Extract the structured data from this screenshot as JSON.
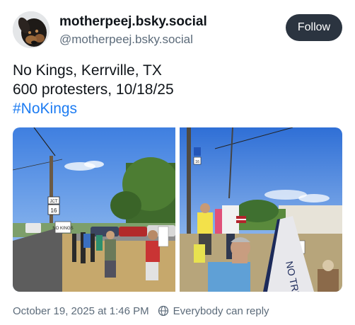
{
  "author": {
    "display_name": "motherpeej.bsky.social",
    "handle": "@motherpeej.bsky.social",
    "avatar_icon": "dog-avatar"
  },
  "follow_button": {
    "label": "Follow"
  },
  "post": {
    "lines": [
      "No Kings, Kerrville, TX",
      "600 protesters, 10/18/25"
    ],
    "hashtag": "#NoKings"
  },
  "images": {
    "left": {
      "sign_text": "NO KINGS",
      "road_sign_top": "JCT",
      "road_sign_number": "16"
    },
    "right": {
      "sign_text": "NO TRUMP",
      "road_sign_number": "16"
    }
  },
  "footer": {
    "timestamp": "October 19, 2025 at 1:46 PM",
    "reply_setting": "Everybody can reply",
    "reply_icon": "globe-icon"
  },
  "colors": {
    "follow_bg": "#2b3440",
    "hashtag": "#1d7cf2",
    "secondary_text": "#5c6b7a"
  }
}
